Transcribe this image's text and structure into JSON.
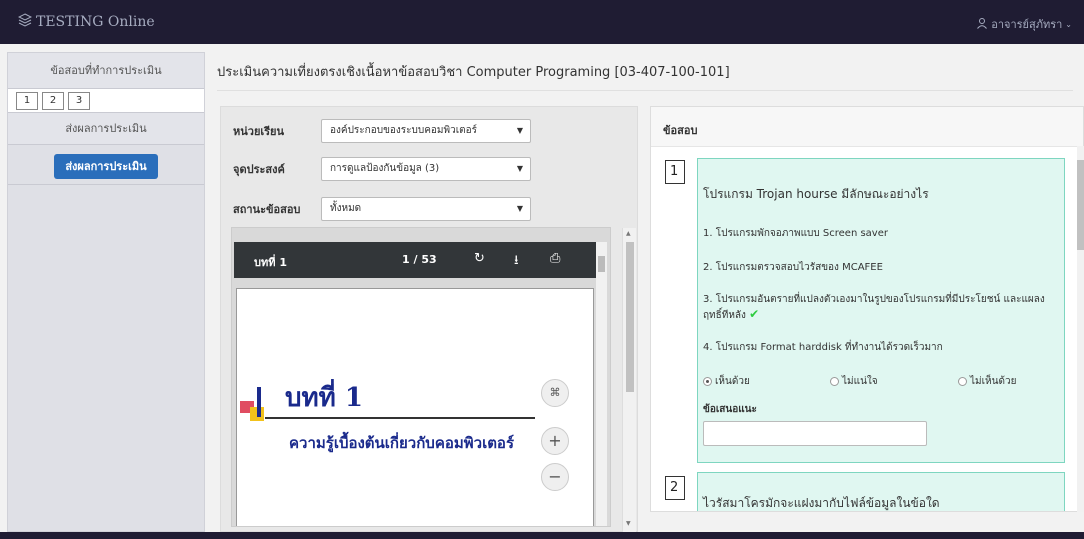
{
  "navbar": {
    "brand": "TESTING Online",
    "brand_icon": "layers-icon",
    "user": "อาจารย์สุภัทรา",
    "user_icon": "user-icon"
  },
  "sidebar": {
    "heading": "ข้อสอบที่ทำการประเมิน",
    "pages": [
      "1",
      "2",
      "3"
    ],
    "send_heading": "ส่งผลการประเมิน",
    "send_button": "ส่งผลการประเมิน"
  },
  "main": {
    "title": "ประเมินความเที่ยงตรงเชิงเนื้อหาข้อสอบวิชา Computer Programing [03-407-100-101]"
  },
  "filters": {
    "unit_label": "หน่วยเรียน",
    "unit_value": "องค์ประกอบของระบบคอมพิวเตอร์",
    "purpose_label": "จุดประสงค์",
    "purpose_value": "การดูแลป้องกันข้อมูล (3)",
    "status_label": "สถานะข้อสอบ",
    "status_value": "ทั้งหมด"
  },
  "pdf": {
    "title": "บทที่ 1",
    "page_indicator": "1 / 53",
    "heading": "บทที่ 1",
    "subtitle": "ความรู้เบื้องต้นเกี่ยวกับคอมพิวเตอร์",
    "icons": [
      "rotate-icon",
      "download-icon",
      "print-icon"
    ]
  },
  "questions": {
    "heading": "ข้อสอบ",
    "items": [
      {
        "number": "1",
        "text": "โปรแกรม Trojan hourse มีลักษณะอย่างไร",
        "options": [
          "1. โปรแกรมพักจอภาพแบบ Screen saver",
          "2. โปรแกรมตรวจสอบไวรัสของ MCAFEE",
          "3. โปรแกรมอันตรายที่แปลงตัวเองมาในรูปของโปรแกรมที่มีประโยชน์ และแผลงฤทธิ์ทีหลัง",
          "4. โปรแกรม Format harddisk ที่ทำงานได้รวดเร็วมาก"
        ],
        "choices": [
          "เห็นด้วย",
          "ไม่แน่ใจ",
          "ไม่เห็นด้วย"
        ],
        "selected_choice": "เห็นด้วย",
        "suggestion_label": "ข้อเสนอแนะ",
        "suggestion_value": ""
      },
      {
        "number": "2",
        "text": "ไวรัสมาโครมักจะแฝงมากับไฟล์ข้อมูลในข้อใด"
      }
    ]
  },
  "colors": {
    "navbar": "#1f1c33",
    "primary_button": "#2a6ebb",
    "question_bg": "#e0f7f1",
    "question_border": "#7ed6c0",
    "correct_check": "#2ecc40"
  }
}
